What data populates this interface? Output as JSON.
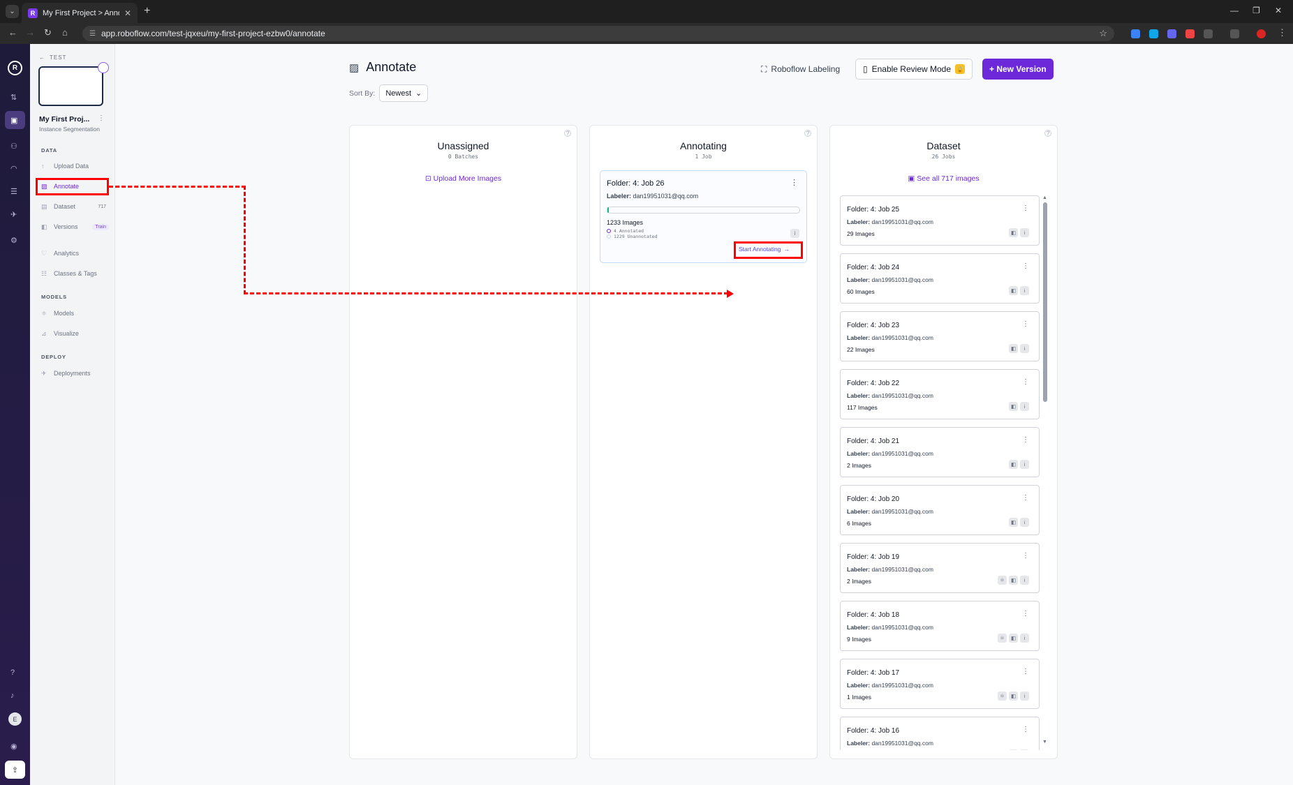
{
  "browser": {
    "tab_title": "My First Project > Annotate",
    "favicon_letter": "R",
    "url": "app.roboflow.com/test-jqxeu/my-first-project-ezbw0/annotate"
  },
  "sidebar": {
    "back_label": "TEST",
    "project_name": "My First Proj...",
    "project_type": "Instance Segmentation",
    "avatar_letter": "E",
    "sections": {
      "data": "DATA",
      "models": "MODELS",
      "deploy": "DEPLOY"
    },
    "items": [
      {
        "label": "Upload Data"
      },
      {
        "label": "Annotate"
      },
      {
        "label": "Dataset",
        "badge": "717"
      },
      {
        "label": "Versions",
        "badge": "Train"
      },
      {
        "label": "Analytics"
      },
      {
        "label": "Classes & Tags"
      },
      {
        "label": "Models"
      },
      {
        "label": "Visualize"
      },
      {
        "label": "Deployments"
      }
    ]
  },
  "header": {
    "title": "Annotate",
    "sort_label": "Sort By:",
    "sort_value": "Newest",
    "roboflow_labeling": "Roboflow Labeling",
    "review_mode": "Enable Review Mode",
    "new_version": "+ New Version"
  },
  "columns": {
    "unassigned": {
      "title": "Unassigned",
      "sub": "0 Batches",
      "link": "Upload More Images"
    },
    "annotating": {
      "title": "Annotating",
      "sub": "1 Job"
    },
    "dataset": {
      "title": "Dataset",
      "sub": "26 Jobs",
      "link": "See all 717 images"
    }
  },
  "active_job": {
    "title": "Folder: 4: Job 26",
    "labeler_label": "Labeler:",
    "labeler": "dan19951031@qq.com",
    "progress": 0.003,
    "count": "1233 Images",
    "annotated": "4 Annotated",
    "unannotated": "1229 Unannotated",
    "start_label": "Start Annotating",
    "start_arrow": "→"
  },
  "dataset_jobs": [
    {
      "title": "Folder: 4: Job 25",
      "labeler": "dan19951031@qq.com",
      "count": "29 Images",
      "extra_icon": false
    },
    {
      "title": "Folder: 4: Job 24",
      "labeler": "dan19951031@qq.com",
      "count": "60 Images",
      "extra_icon": false
    },
    {
      "title": "Folder: 4: Job 23",
      "labeler": "dan19951031@qq.com",
      "count": "22 Images",
      "extra_icon": false
    },
    {
      "title": "Folder: 4: Job 22",
      "labeler": "dan19951031@qq.com",
      "count": "117 Images",
      "extra_icon": false
    },
    {
      "title": "Folder: 4: Job 21",
      "labeler": "dan19951031@qq.com",
      "count": "2 Images",
      "extra_icon": false
    },
    {
      "title": "Folder: 4: Job 20",
      "labeler": "dan19951031@qq.com",
      "count": "6 Images",
      "extra_icon": false
    },
    {
      "title": "Folder: 4: Job 19",
      "labeler": "dan19951031@qq.com",
      "count": "2 Images",
      "extra_icon": true
    },
    {
      "title": "Folder: 4: Job 18",
      "labeler": "dan19951031@qq.com",
      "count": "9 Images",
      "extra_icon": true
    },
    {
      "title": "Folder: 4: Job 17",
      "labeler": "dan19951031@qq.com",
      "count": "1 Images",
      "extra_icon": true
    },
    {
      "title": "Folder: 4: Job 16",
      "labeler": "dan19951031@qq.com",
      "count": "",
      "extra_icon": false
    }
  ],
  "labels": {
    "labeler": "Labeler:"
  }
}
